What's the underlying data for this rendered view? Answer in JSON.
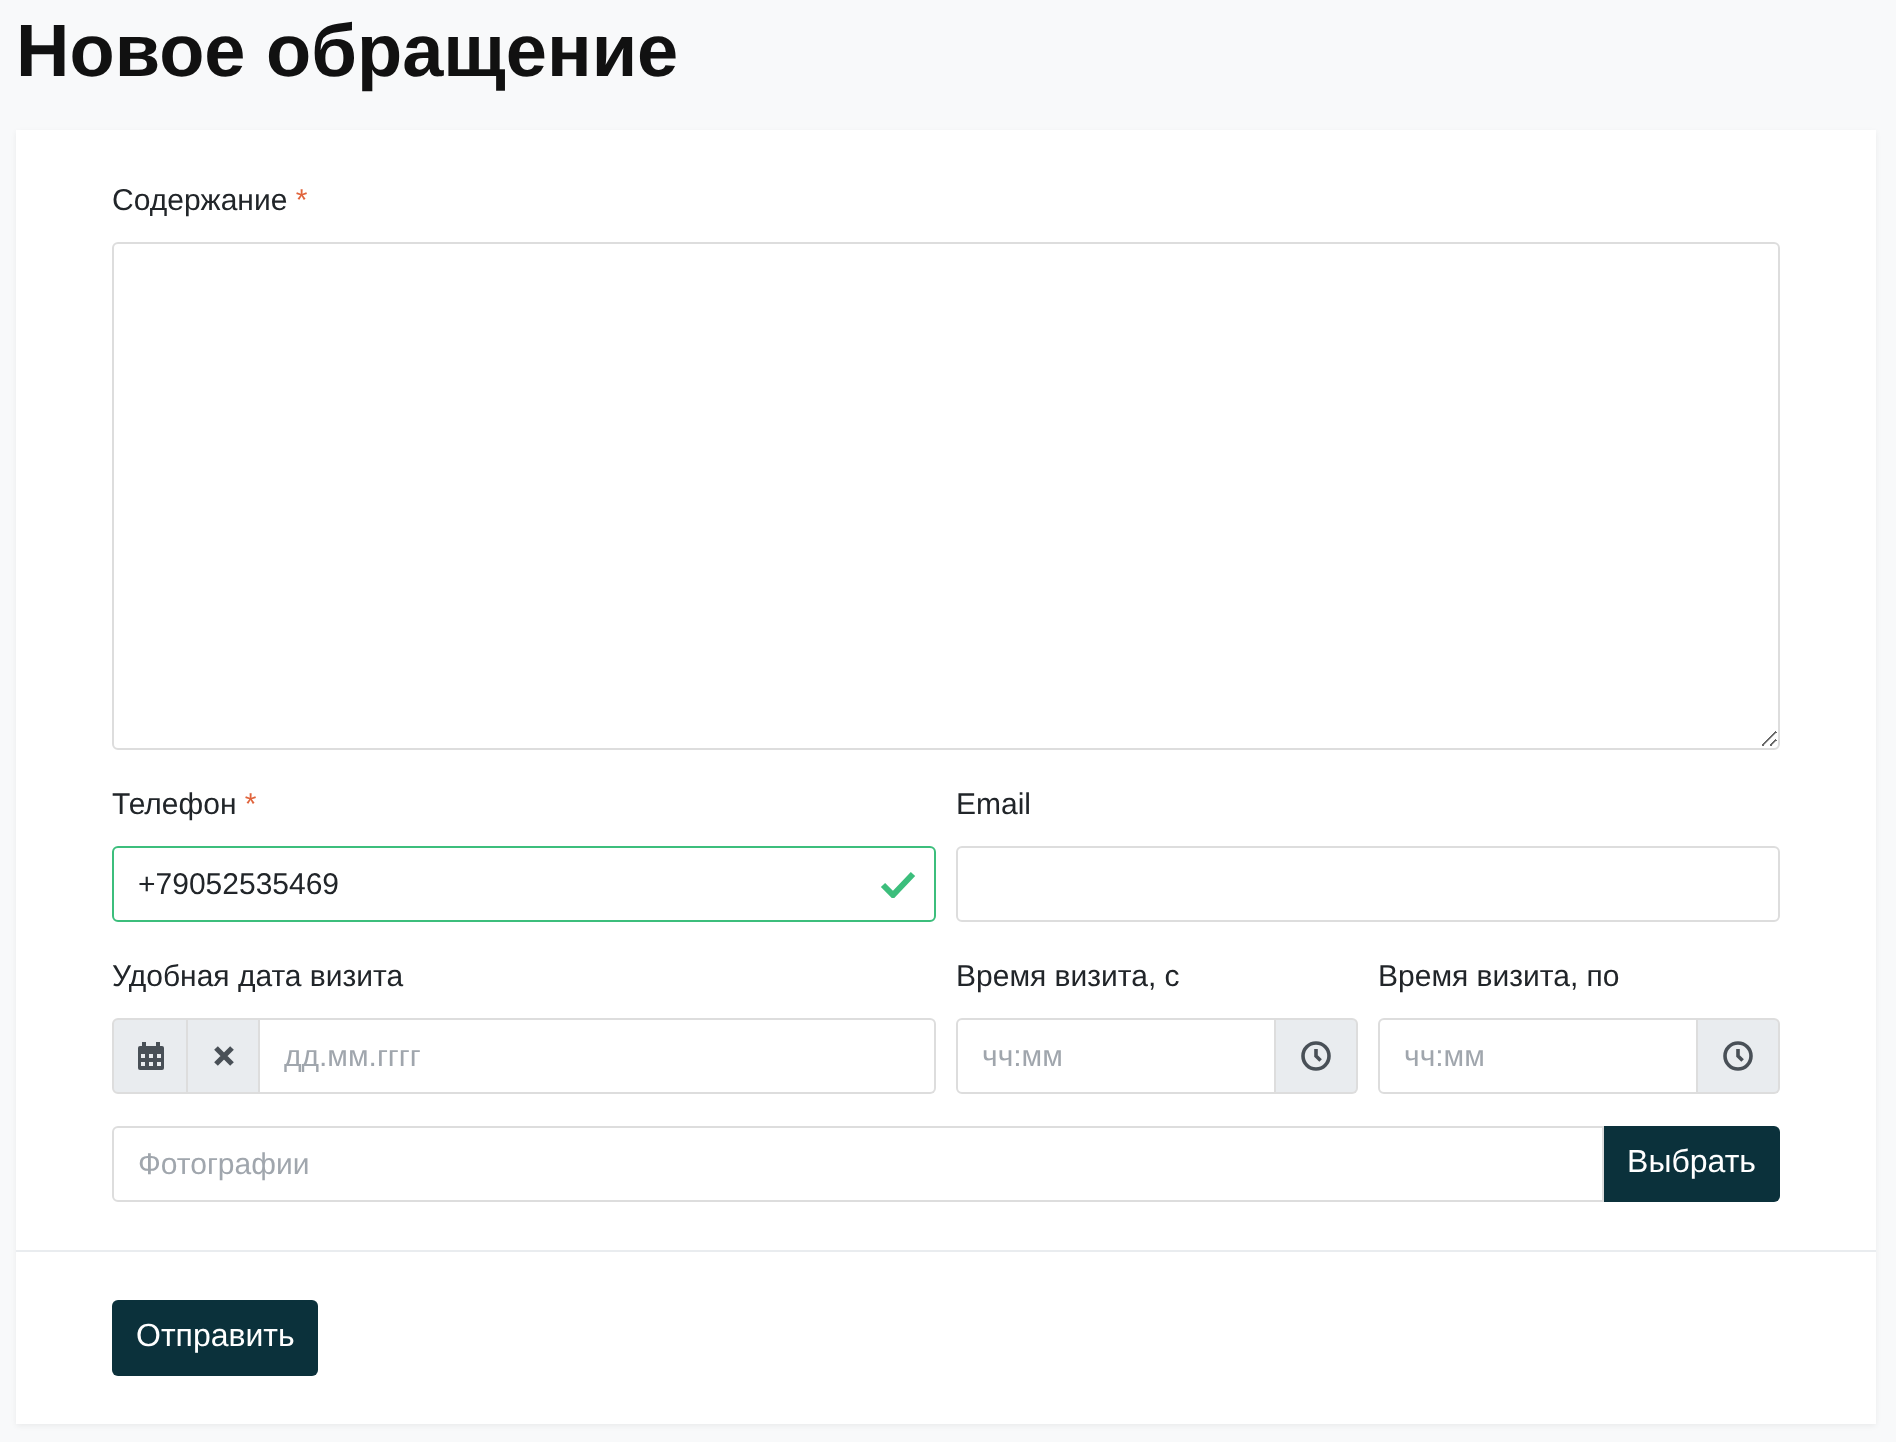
{
  "title": "Новое обращение",
  "content": {
    "label": "Содержание",
    "required_mark": "*"
  },
  "phone": {
    "label": "Телефон",
    "required_mark": "*",
    "value": "+79052535469",
    "valid": true
  },
  "email": {
    "label": "Email"
  },
  "date": {
    "label": "Удобная дата визита",
    "placeholder": "дд.мм.гггг"
  },
  "time_from": {
    "label": "Время визита, с",
    "placeholder": "чч:мм"
  },
  "time_to": {
    "label": "Время визита, по",
    "placeholder": "чч:мм"
  },
  "photos": {
    "placeholder": "Фотографии",
    "button": "Выбрать"
  },
  "submit": "Отправить"
}
